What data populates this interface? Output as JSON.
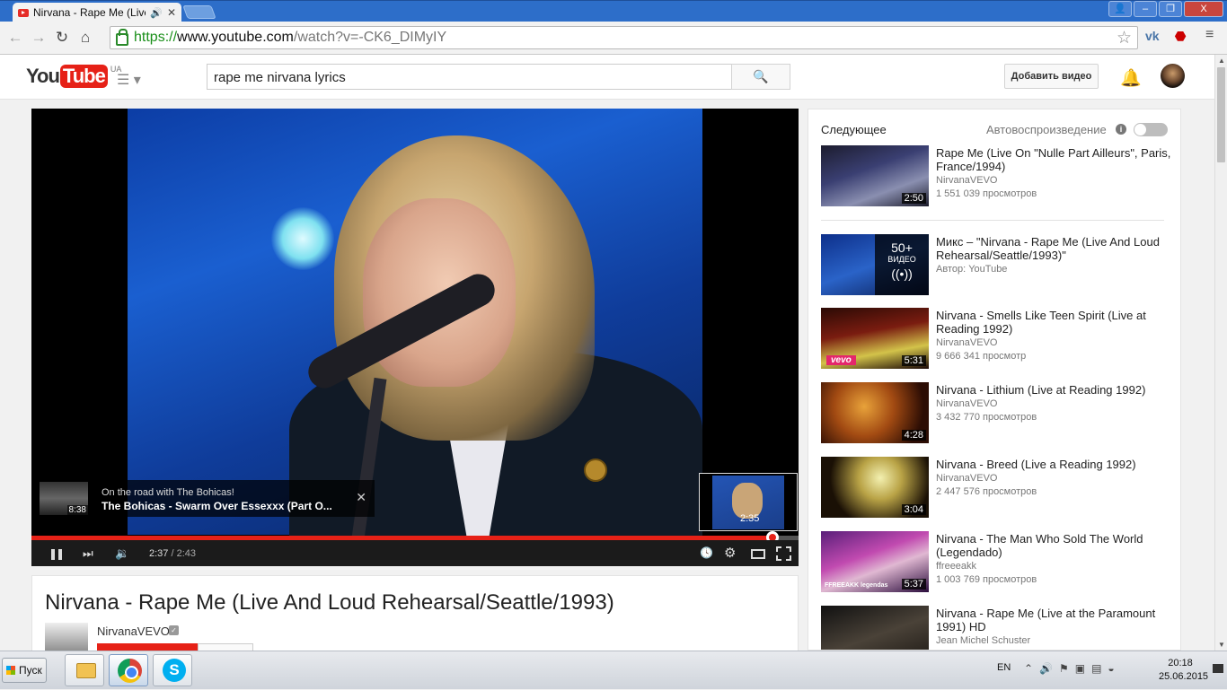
{
  "browser": {
    "tab_title": "Nirvana - Rape Me (Live /",
    "tab_audio_icon": "speaker-icon",
    "url_scheme": "https://",
    "url_host": "www.youtube.com",
    "url_path": "/watch?v=-CK6_DIMyIY",
    "win_minimize": "–",
    "win_maximize": "❐",
    "win_close": "X"
  },
  "header": {
    "logo_you": "You",
    "logo_tube": "Tube",
    "logo_region": "UA",
    "search_value": "rape me nirvana lyrics",
    "upload_label": "Добавить видео"
  },
  "player": {
    "endcard_channel": "On the road with The Bohicas!",
    "endcard_title": "The Bohicas - Swarm Over Essexxx (Part O...",
    "endcard_duration": "8:38",
    "storyboard_time": "2:35",
    "time_current": "2:37",
    "time_sep": " / ",
    "time_duration": "2:43",
    "progress_fraction": 0.9655
  },
  "video": {
    "title": "Nirvana - Rape Me (Live And Loud Rehearsal/Seattle/1993)",
    "channel": "NirvanaVEVO"
  },
  "sidebar": {
    "up_next_label": "Следующее",
    "autoplay_label": "Автовоспроизведение",
    "items": [
      {
        "title": "Rape Me (Live On \"Nulle Part Ailleurs\", Paris, France/1994)",
        "channel": "NirvanaVEVO",
        "views": "1 551 039 просмотров",
        "duration": "2:50"
      },
      {
        "title": "Микс – \"Nirvana - Rape Me (Live And Loud Rehearsal/Seattle/1993)\"",
        "channel": "Автор: YouTube",
        "views": "",
        "duration": "",
        "mix_count": "50+",
        "mix_label": "ВИДЕО"
      },
      {
        "title": "Nirvana - Smells Like Teen Spirit (Live at Reading 1992)",
        "channel": "NirvanaVEVO",
        "views": "9 666 341 просмотр",
        "duration": "5:31",
        "badge": "vevo"
      },
      {
        "title": "Nirvana - Lithium (Live at Reading 1992)",
        "channel": "NirvanaVEVO",
        "views": "3 432 770 просмотров",
        "duration": "4:28"
      },
      {
        "title": "Nirvana - Breed (Live a Reading 1992)",
        "channel": "NirvanaVEVO",
        "views": "2 447 576 просмотров",
        "duration": "3:04"
      },
      {
        "title": "Nirvana - The Man Who Sold The World (Legendado)",
        "channel": "ffreeeakk",
        "views": "1 003 769 просмотров",
        "duration": "5:37",
        "badge": "FFREEAKK legendas"
      },
      {
        "title": "Nirvana - Rape Me (Live at the Paramount 1991) HD",
        "channel": "Jean Michel Schuster",
        "views": "",
        "duration": ""
      }
    ]
  },
  "taskbar": {
    "start_label": "Пуск",
    "lang": "EN",
    "time": "20:18",
    "date": "25.06.2015"
  },
  "colors": {
    "youtube_red": "#e62117",
    "chrome_tabbar": "#2d6ec9",
    "link_green": "#1a8f1a"
  }
}
